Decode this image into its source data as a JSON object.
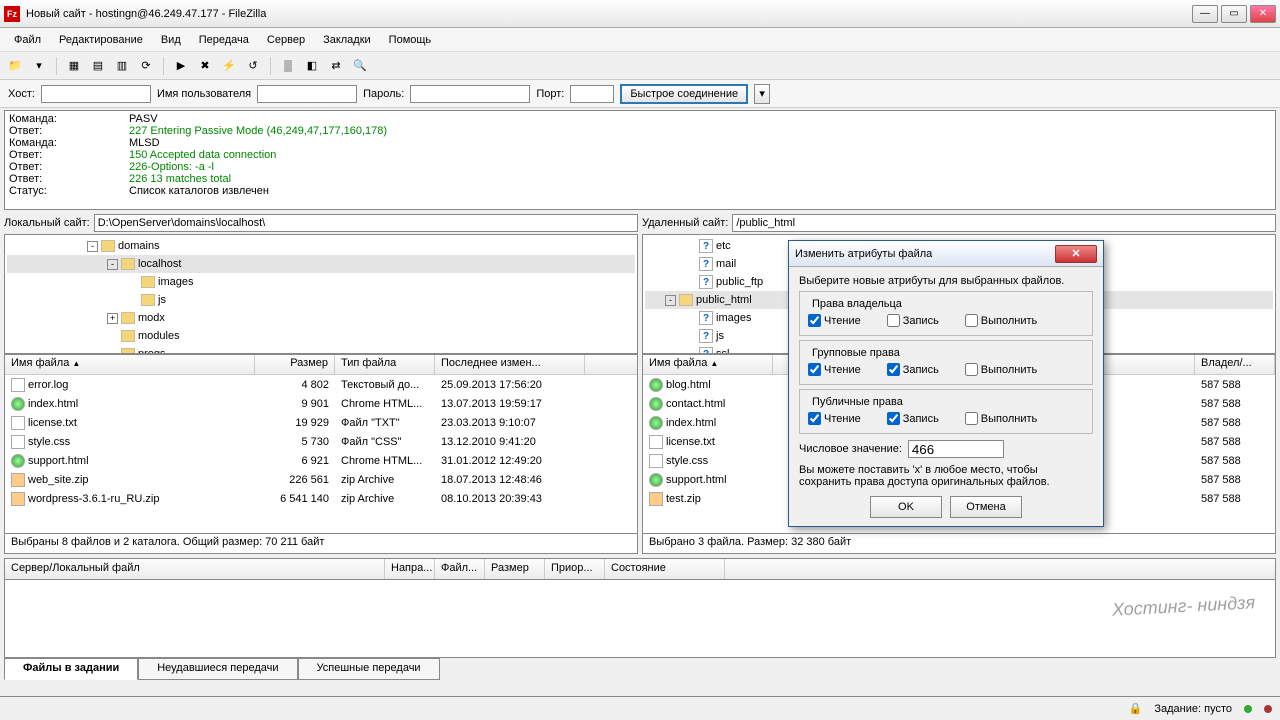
{
  "window": {
    "title": "Новый сайт - hostingn@46.249.47.177 - FileZilla"
  },
  "menu": [
    "Файл",
    "Редактирование",
    "Вид",
    "Передача",
    "Сервер",
    "Закладки",
    "Помощь"
  ],
  "quickconnect": {
    "host_lbl": "Хост:",
    "user_lbl": "Имя пользователя",
    "pass_lbl": "Пароль:",
    "port_lbl": "Порт:",
    "btn": "Быстрое соединение"
  },
  "log": [
    {
      "lbl": "Команда:",
      "txt": "PASV",
      "cls": ""
    },
    {
      "lbl": "Ответ:",
      "txt": "227 Entering Passive Mode (46,249,47,177,160,178)",
      "cls": "green"
    },
    {
      "lbl": "Команда:",
      "txt": "MLSD",
      "cls": ""
    },
    {
      "lbl": "Ответ:",
      "txt": "150 Accepted data connection",
      "cls": "green"
    },
    {
      "lbl": "Ответ:",
      "txt": "226-Options: -a -l",
      "cls": "green"
    },
    {
      "lbl": "Ответ:",
      "txt": "226 13 matches total",
      "cls": "green"
    },
    {
      "lbl": "Статус:",
      "txt": "Список каталогов извлечен",
      "cls": ""
    }
  ],
  "local": {
    "path_lbl": "Локальный сайт:",
    "path": "D:\\OpenServer\\domains\\localhost\\",
    "tree": [
      {
        "indent": 80,
        "exp": "-",
        "name": "domains"
      },
      {
        "indent": 100,
        "exp": "-",
        "name": "localhost",
        "sel": true
      },
      {
        "indent": 120,
        "exp": "",
        "name": "images"
      },
      {
        "indent": 120,
        "exp": "",
        "name": "js"
      },
      {
        "indent": 100,
        "exp": "+",
        "name": "modx"
      },
      {
        "indent": 100,
        "exp": "",
        "name": "modules"
      },
      {
        "indent": 100,
        "exp": "",
        "name": "progs"
      }
    ],
    "cols": [
      "Имя файла",
      "Размер",
      "Тип файла",
      "Последнее измен..."
    ],
    "files": [
      {
        "name": "error.log",
        "icon": "txt",
        "size": "4 802",
        "type": "Текстовый до...",
        "date": "25.09.2013 17:56:20"
      },
      {
        "name": "index.html",
        "icon": "html",
        "size": "9 901",
        "type": "Chrome HTML...",
        "date": "13.07.2013 19:59:17"
      },
      {
        "name": "license.txt",
        "icon": "txt",
        "size": "19 929",
        "type": "Файл \"TXT\"",
        "date": "23.03.2013 9:10:07"
      },
      {
        "name": "style.css",
        "icon": "txt",
        "size": "5 730",
        "type": "Файл \"CSS\"",
        "date": "13.12.2010 9:41:20"
      },
      {
        "name": "support.html",
        "icon": "html",
        "size": "6 921",
        "type": "Chrome HTML...",
        "date": "31.01.2012 12:49:20"
      },
      {
        "name": "web_site.zip",
        "icon": "zip",
        "size": "226 561",
        "type": "zip Archive",
        "date": "18.07.2013 12:48:46"
      },
      {
        "name": "wordpress-3.6.1-ru_RU.zip",
        "icon": "zip",
        "size": "6 541 140",
        "type": "zip Archive",
        "date": "08.10.2013 20:39:43"
      }
    ],
    "status": "Выбраны 8 файлов и 2 каталога. Общий размер: 70 211 байт"
  },
  "remote": {
    "path_lbl": "Удаленный сайт:",
    "path": "/public_html",
    "tree": [
      {
        "indent": 40,
        "q": true,
        "name": "etc"
      },
      {
        "indent": 40,
        "q": true,
        "name": "mail"
      },
      {
        "indent": 40,
        "q": true,
        "name": "public_ftp"
      },
      {
        "indent": 20,
        "exp": "-",
        "name": "public_html",
        "sel": true
      },
      {
        "indent": 40,
        "q": true,
        "name": "images"
      },
      {
        "indent": 40,
        "q": true,
        "name": "js"
      },
      {
        "indent": 40,
        "q": true,
        "name": "ssl"
      }
    ],
    "cols": [
      "Имя файла",
      "Владел/..."
    ],
    "files": [
      {
        "name": "blog.html",
        "icon": "html",
        "owner": "587 588"
      },
      {
        "name": "contact.html",
        "icon": "html",
        "owner": "587 588"
      },
      {
        "name": "index.html",
        "icon": "html",
        "owner": "587 588"
      },
      {
        "name": "license.txt",
        "icon": "txt",
        "owner": "587 588"
      },
      {
        "name": "style.css",
        "icon": "txt",
        "owner": "587 588"
      },
      {
        "name": "support.html",
        "icon": "html",
        "owner": "587 588"
      },
      {
        "name": "test.zip",
        "icon": "zip",
        "owner": "587 588"
      }
    ],
    "status": "Выбрано 3 файла. Размер: 32 380 байт"
  },
  "queue": {
    "cols": [
      "Сервер/Локальный файл",
      "Напра...",
      "Файл...",
      "Размер",
      "Приор...",
      "Состояние"
    ],
    "tabs": [
      "Файлы в задании",
      "Неудавшиеся передачи",
      "Успешные передачи"
    ]
  },
  "footer": {
    "queue_lbl": "Задание: пусто"
  },
  "dialog": {
    "title": "Изменить атрибуты файла",
    "instr": "Выберите новые атрибуты для выбранных файлов.",
    "groups": [
      {
        "title": "Права владельца",
        "read": true,
        "write": false,
        "exec": false
      },
      {
        "title": "Групповые права",
        "read": true,
        "write": true,
        "exec": false
      },
      {
        "title": "Публичные права",
        "read": true,
        "write": true,
        "exec": false
      }
    ],
    "labels": {
      "read": "Чтение",
      "write": "Запись",
      "exec": "Выполнить"
    },
    "num_lbl": "Числовое значение:",
    "num_val": "466",
    "hint": "Вы можете поставить 'x' в любое место, чтобы сохранить права доступа оригинальных файлов.",
    "ok": "OK",
    "cancel": "Отмена"
  },
  "watermark": "Хостинг-\nниндзя"
}
